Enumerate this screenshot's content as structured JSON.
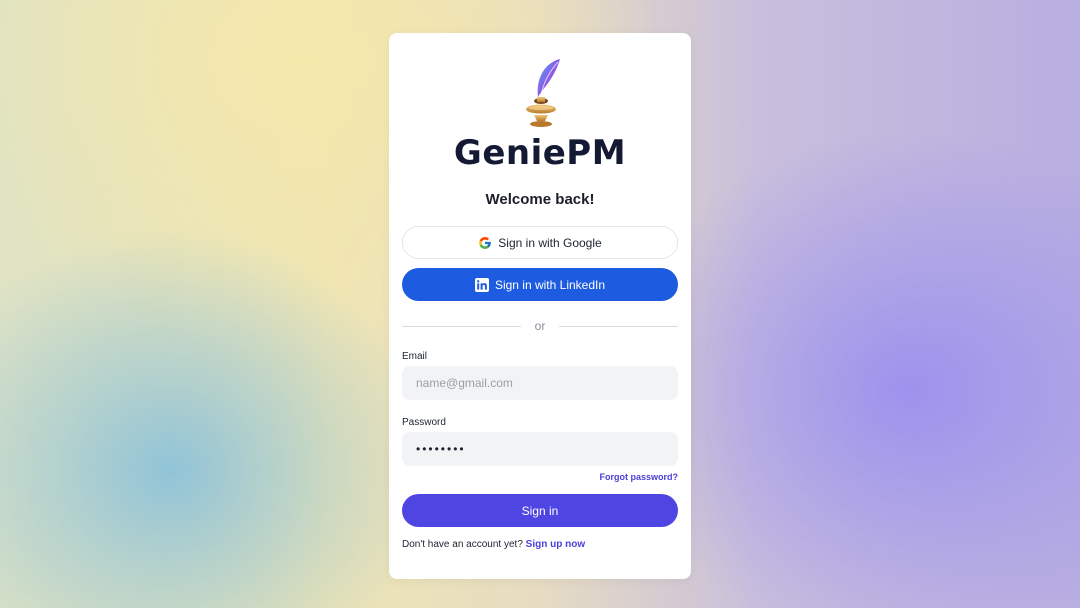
{
  "brand": {
    "name": "GeniePM",
    "logo_icon": "genie-lamp-quill-icon"
  },
  "heading": "Welcome back!",
  "oauth": {
    "google_label": "Sign in with Google",
    "linkedin_label": "Sign in with LinkedIn"
  },
  "divider_text": "or",
  "form": {
    "email_label": "Email",
    "email_placeholder": "name@gmail.com",
    "password_label": "Password",
    "password_value": "••••••••",
    "forgot_label": "Forgot password?",
    "submit_label": "Sign in"
  },
  "signup": {
    "prompt": "Don't have an account yet?",
    "link_label": "Sign up now"
  },
  "colors": {
    "linkedin_blue": "#1d5be0",
    "primary": "#4e45e3",
    "link": "#4a3fd8"
  }
}
